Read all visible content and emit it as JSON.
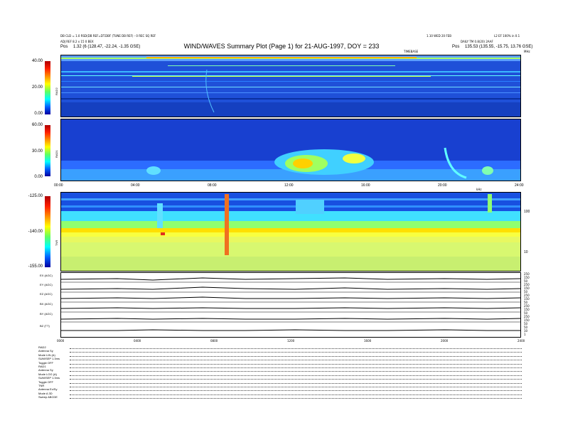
{
  "header": {
    "line1": "DB CLD = 1.0 RSD(DB REF=DT.DBF (TUNE DB REF) - 0 REC SQ REF",
    "line2": "ADJ REF 8.2 x 15 0 BEX",
    "pos_left_label": "Pos",
    "pos_left_value": "1.32 (6 (128.47, -22.24, -1.35 GSE)",
    "title": "WIND/WAVES Summary Plot (Page 1) for 21-AUG-1997, DOY = 233",
    "right_line1": "1.10 WED 20 FEB",
    "right_line2": "L2 EF 100% in 0.1",
    "right_line3": "DAILY TM 0.8(20) 2AAF",
    "pos_right_label": "Pos",
    "pos_right_value": "135.53 (135.55, -15.75, 13.76 GSE)",
    "timebase_label": "TIMEBASE",
    "mhz_label": "MHz",
    "khz_label": "kHz"
  },
  "panel1": {
    "ylabel": "RAD2",
    "yticks": [
      "40.00",
      "20.00",
      "0.00"
    ]
  },
  "panel2": {
    "ylabel": "RAD1",
    "yticks": [
      "60.00",
      "30.00",
      "0.00"
    ]
  },
  "time_axis": [
    "00:00",
    "04:00",
    "08:00",
    "12:00",
    "16:00",
    "20:00",
    "24:00"
  ],
  "panel3": {
    "ylabel": "TNR",
    "yticks": [
      "-125.00",
      "-140.00",
      "-155.00"
    ],
    "right_ticks": [
      "100",
      "10"
    ]
  },
  "traces": {
    "labels": [
      "EX (AGC)",
      "EY (AGC)",
      "EZ (AGC)",
      "BX (AGC)",
      "BY (AGC)",
      "BZ (TT)"
    ],
    "right_ticks": [
      "250",
      "150",
      "50",
      "250",
      "150",
      "50",
      "250",
      "150",
      "50",
      "250",
      "150",
      "50",
      "250",
      "150",
      "50",
      "50",
      "10",
      "1"
    ],
    "bottom_time_axis": [
      "0000",
      "0400",
      "0800",
      "1200",
      "1600",
      "2000",
      "2400"
    ]
  },
  "footer_rows": [
    {
      "label": "RAD2",
      "value": ""
    },
    {
      "label": "Antenna",
      "value": "Sy"
    },
    {
      "label": "Mode",
      "value": "LIN (A)"
    },
    {
      "label": "SUM/SEP",
      "value": "1.3ms"
    },
    {
      "label": "Toggle",
      "value": "OFF"
    },
    {
      "label": "RAD1",
      "value": ""
    },
    {
      "label": "Antenna",
      "value": "Sy"
    },
    {
      "label": "Mode",
      "value": "LOG (A)"
    },
    {
      "label": "SUM/SEP",
      "value": "1.3ms"
    },
    {
      "label": "Toggle",
      "value": "OFF"
    },
    {
      "label": "TNR",
      "value": ""
    },
    {
      "label": "Antenna",
      "value": "Ex/Sy"
    },
    {
      "label": "Mode",
      "value": "A 3D"
    },
    {
      "label": "Sweep",
      "value": "ABCDE"
    }
  ],
  "colors": {
    "colormap": [
      "#b00000",
      "#ff2000",
      "#ff9000",
      "#ffff00",
      "#60ff60",
      "#00ffff",
      "#0060ff",
      "#0000a0"
    ],
    "background_blue": "#1f50d8"
  },
  "chart_data": {
    "type": "heatmap",
    "title": "WIND/WAVES Summary Plot (Page 1) for 21-AUG-1997, DOY = 233",
    "x_range": [
      "00:00",
      "24:00"
    ],
    "panels": [
      {
        "name": "RAD2",
        "ylim": [
          0,
          40
        ],
        "units": "MHz"
      },
      {
        "name": "RAD1",
        "ylim": [
          0,
          60
        ]
      },
      {
        "name": "TNR",
        "ylim": [
          -155,
          -125
        ]
      }
    ],
    "grid": false
  }
}
